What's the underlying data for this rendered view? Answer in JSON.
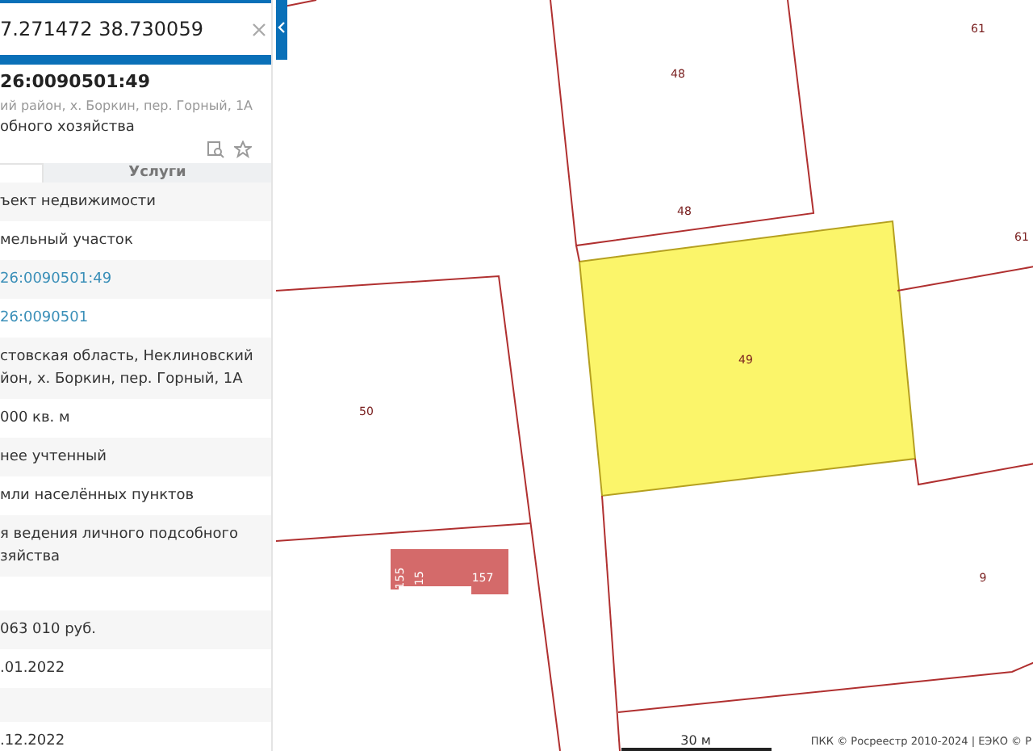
{
  "search": {
    "value": "7.271472 38.730059"
  },
  "object": {
    "title": "26:0090501:49",
    "address": "ий район, х. Боркин, пер. Горный, 1А",
    "subtitle": "обного хозяйства"
  },
  "tabs": [
    {
      "selected": true
    },
    {
      "label": "Услуги",
      "selected": false
    }
  ],
  "rows": [
    {
      "value": "ъект недвижимости",
      "kind": "text"
    },
    {
      "value": "мельный участок",
      "kind": "text"
    },
    {
      "value": "26:0090501:49",
      "kind": "link"
    },
    {
      "value": "26:0090501",
      "kind": "link"
    },
    {
      "value": "стовская область, Неклиновский\nйон, х. Боркин, пер. Горный, 1А",
      "kind": "text"
    },
    {
      "value": "000 кв. м",
      "kind": "text"
    },
    {
      "value": "нее учтенный",
      "kind": "text"
    },
    {
      "value": "мли населённых пунктов",
      "kind": "text"
    },
    {
      "value": "я ведения личного подсобного\nзяйства",
      "kind": "text"
    },
    {
      "value": "",
      "kind": "empty"
    },
    {
      "value": "063 010 руб.",
      "kind": "text"
    },
    {
      "value": ".01.2022",
      "kind": "text"
    },
    {
      "value": "",
      "kind": "empty"
    },
    {
      "value": ".12.2022",
      "kind": "text"
    }
  ],
  "map": {
    "labels": [
      "48",
      "48",
      "61",
      "61",
      "49",
      "50",
      "155",
      "15",
      "157",
      "9"
    ],
    "scale": "30 м",
    "attribution": "ПКК © Росреестр 2010-2024 | ЕЭКО © Р"
  }
}
